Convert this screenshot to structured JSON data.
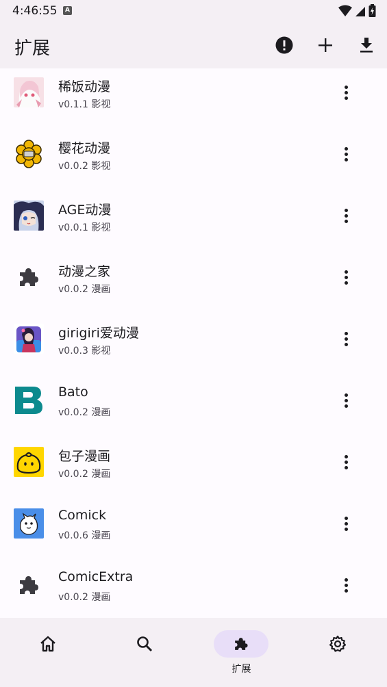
{
  "status": {
    "time": "4:46:55",
    "keyboard_badge": "A"
  },
  "appbar": {
    "title": "扩展"
  },
  "extensions": [
    {
      "name": "稀饭动漫",
      "version": "v0.1.1",
      "type": "影视"
    },
    {
      "name": "樱花动漫",
      "version": "v0.0.2",
      "type": "影视"
    },
    {
      "name": "AGE动漫",
      "version": "v0.0.1",
      "type": "影视"
    },
    {
      "name": "动漫之家",
      "version": "v0.0.2",
      "type": "漫画"
    },
    {
      "name": "girigiri爱动漫",
      "version": "v0.0.3",
      "type": "影视"
    },
    {
      "name": "Bato",
      "version": "v0.0.2",
      "type": "漫画"
    },
    {
      "name": "包子漫画",
      "version": "v0.0.2",
      "type": "漫画"
    },
    {
      "name": "Comick",
      "version": "v0.0.6",
      "type": "漫画"
    },
    {
      "name": "ComicExtra",
      "version": "v0.0.2",
      "type": "漫画"
    }
  ],
  "nav": {
    "active_label": "扩展"
  },
  "colors": {
    "accent": "#e8def8",
    "bato": "#0d8a8e",
    "baozi": "#ffd600",
    "comick": "#4a8ee8"
  }
}
